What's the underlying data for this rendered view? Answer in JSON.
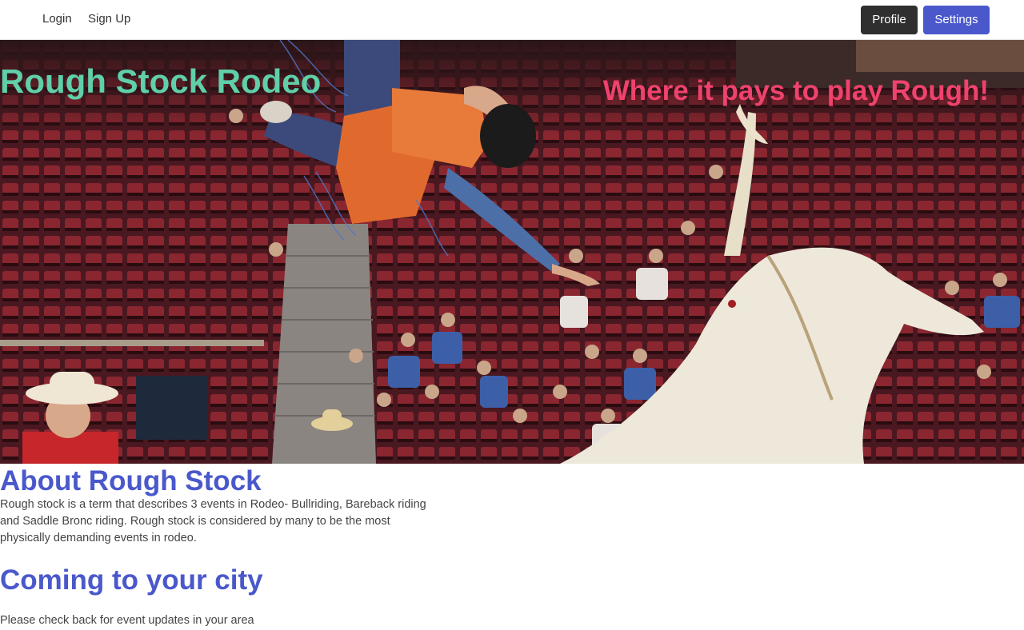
{
  "nav": {
    "login_label": "Login",
    "signup_label": "Sign Up",
    "profile_label": "Profile",
    "settings_label": "Settings"
  },
  "hero": {
    "title": "Rough Stock Rodeo",
    "tagline": "Where it pays to play Rough!",
    "image": "rodeo-bull-riding-photo"
  },
  "about": {
    "heading": "About Rough Stock",
    "text": "Rough stock is a term that describes 3 events in Rodeo- Bullriding, Bareback riding and Saddle Bronc riding. Rough stock is considered by many to be the most physically demanding events in rodeo."
  },
  "city": {
    "heading": "Coming to your city",
    "text": "Please check back for event updates in your area"
  },
  "colors": {
    "title_green": "#5fd0a9",
    "tagline_pink": "#f0426e",
    "heading_blue": "#4a58cc",
    "profile_button": "#2f2f2f",
    "settings_button": "#4a58cc"
  }
}
